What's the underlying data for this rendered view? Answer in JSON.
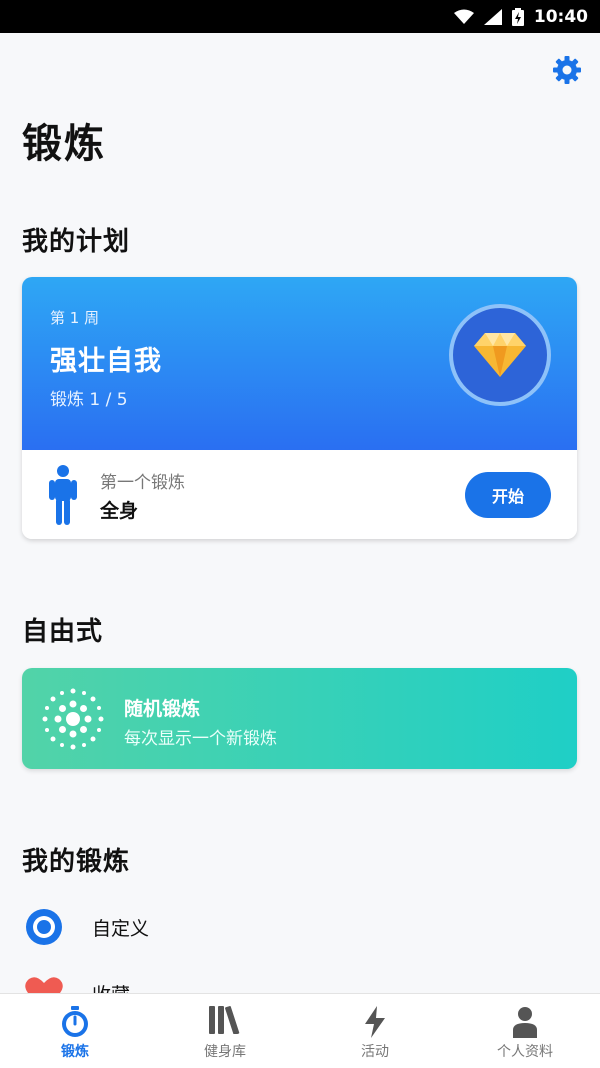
{
  "status_bar": {
    "time": "10:40"
  },
  "header": {
    "title": "锻炼"
  },
  "plan_section": {
    "title": "我的计划",
    "card": {
      "week": "第 1 周",
      "name": "强壮自我",
      "progress": "锻炼 1 / 5",
      "badge_icon": "diamond-icon",
      "first_label": "第一个锻炼",
      "first_name": "全身",
      "start_button": "开始"
    }
  },
  "free_section": {
    "title": "自由式",
    "card": {
      "title": "随机锻炼",
      "subtitle": "每次显示一个新锻炼"
    }
  },
  "my_workouts": {
    "title": "我的锻炼",
    "items": [
      {
        "label": "自定义",
        "icon": "target-icon"
      },
      {
        "label": "收藏",
        "icon": "heart-icon"
      }
    ]
  },
  "tabs": [
    {
      "label": "锻炼",
      "icon": "stopwatch-icon",
      "active": true
    },
    {
      "label": "健身库",
      "icon": "library-icon",
      "active": false
    },
    {
      "label": "活动",
      "icon": "lightning-icon",
      "active": false
    },
    {
      "label": "个人资料",
      "icon": "person-icon",
      "active": false
    }
  ],
  "colors": {
    "accent": "#1a73e8",
    "plan_gradient": [
      "#2ea7f4",
      "#2a6ff2"
    ],
    "random_gradient": [
      "#52d3a8",
      "#1fcfc6"
    ],
    "badge_gold": "#f7b733"
  }
}
